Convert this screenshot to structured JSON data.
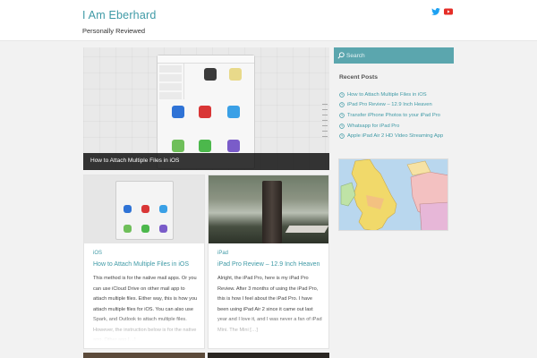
{
  "site": {
    "title": "I Am Eberhard",
    "tagline": "Personally Reviewed"
  },
  "social": [
    {
      "name": "twitter-icon",
      "color": "#1da1f2"
    },
    {
      "name": "youtube-icon",
      "color": "#e52d27"
    }
  ],
  "hero": {
    "caption": "How to Attach Multiple Files in iOS"
  },
  "posts": [
    {
      "category": "iOS",
      "title": "How to Attach Multiple Files in iOS",
      "excerpt": "This method is for the native mail apps. Or you can use iCloud Drive on other mail app to attach multiple files. Either way, this is how you attach multiple files for iOS. You can also use Spark, and Outlook to attach multiple files. However, the instruction below is for the native app. Other app […]"
    },
    {
      "category": "iPad",
      "title": "iPad Pro Review – 12.9 Inch Heaven",
      "excerpt": "Alright, the iPad Pro, here is my iPad Pro Review. After 3 months of using the iPad Pro, this is how I feel about the iPad Pro. I have been using iPad Air 2 since it came out last year and I love it, and I was never a fan of iPad Mini. The Mini […]"
    }
  ],
  "sidebar": {
    "search_placeholder": "Search",
    "recent_title": "Recent Posts",
    "recent_posts": [
      "How to Attach Multiple Files in iOS",
      "iPad Pro Review – 12.9 Inch Heaven",
      "Transfer iPhone Photos to your iPad Pro",
      "Whatsapp for iPad Pro",
      "Apple iPad Air 2 HD Video Streaming App"
    ]
  },
  "colors": {
    "accent": "#3f9aa6",
    "search_bg": "#5ba6ae"
  }
}
